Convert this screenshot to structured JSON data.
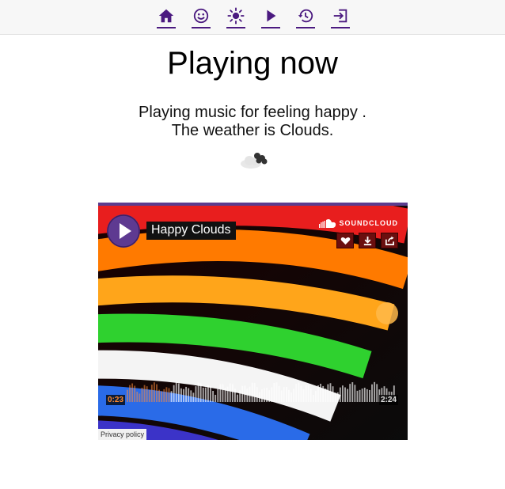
{
  "nav": {
    "items": [
      {
        "icon": "home-icon",
        "color": "#4b1a80"
      },
      {
        "icon": "smiley-icon",
        "color": "#4b1a80"
      },
      {
        "icon": "sun-icon",
        "color": "#4b1a80"
      },
      {
        "icon": "play-icon",
        "color": "#4b1a80"
      },
      {
        "icon": "history-icon",
        "color": "#4b1a80"
      },
      {
        "icon": "logout-icon",
        "color": "#4b1a80"
      }
    ]
  },
  "main": {
    "title": "Playing now",
    "line1": "Playing music for feeling happy .",
    "line2": "The weather is Clouds.",
    "weather_icon": "clouds-icon"
  },
  "player": {
    "track_title": "Happy Clouds",
    "brand": "SOUNDCLOUD",
    "current_time": "0:23",
    "duration": "2:24",
    "progress": 0.16,
    "privacy_label": "Privacy policy",
    "accent": "#5e3a91",
    "progress_color": "#ff5500"
  }
}
